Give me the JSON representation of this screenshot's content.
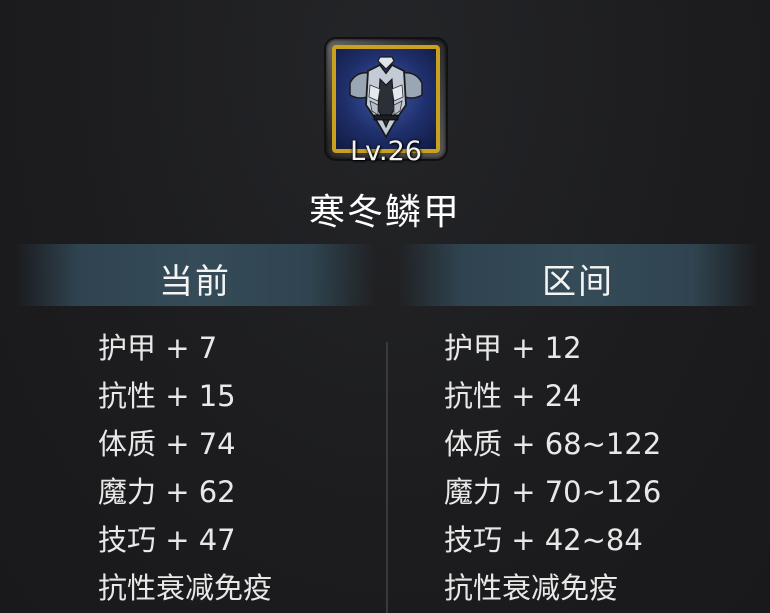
{
  "item": {
    "icon": "armor-chestplate-icon",
    "level_label": "Lv.26",
    "name": "寒冬鳞甲",
    "frame_color": "#c9a11f"
  },
  "headers": {
    "current": "当前",
    "range": "区间"
  },
  "current_stats": [
    "护甲 + 7",
    "抗性 + 15",
    "体质 + 74",
    "魔力 + 62",
    "技巧 + 47",
    "抗性衰减免疫"
  ],
  "range_stats": [
    "护甲 + 12",
    "抗性 + 24",
    "体质 + 68~122",
    "魔力 + 70~126",
    "技巧 + 42~84",
    "抗性衰减免疫"
  ]
}
